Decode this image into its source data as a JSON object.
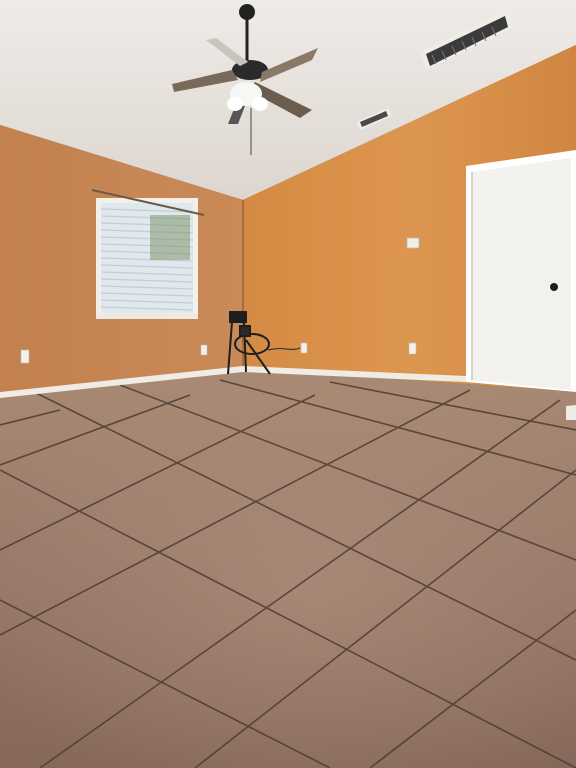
{
  "scene": {
    "description_free_photo": true
  },
  "colors": {
    "ceiling": "#e9e4df",
    "ceiling_shadow": "#d6cfc8",
    "wall_left": "#c98752",
    "wall_left_dark": "#b87545",
    "wall_right": "#d58b40",
    "wall_right_light": "#e09a52",
    "floor": "#9d7f6b",
    "floor_dark": "#7e6352",
    "grout": "#4a3a30",
    "baseboard": "#f2efe9",
    "door": "#f4f2ee",
    "door_frame": "#ffffff",
    "window_glass": "#dfe8ef",
    "fan_body": "#2b2b2b",
    "fan_blade": "#7a6a5a",
    "vent": "#3b3b3b"
  },
  "icons": {
    "ceiling_fan": "ceiling-fan-icon",
    "air_vent": "air-vent-icon",
    "outlet": "electrical-outlet-icon",
    "door_knob": "door-knob-icon",
    "thermostat": "thermostat-icon",
    "chair": "chair-icon"
  }
}
